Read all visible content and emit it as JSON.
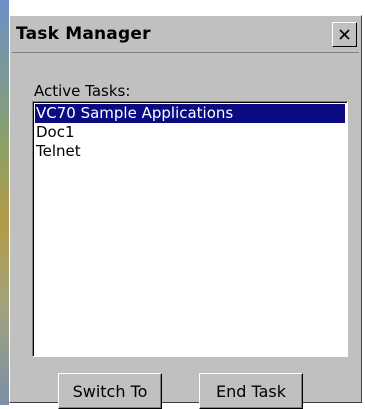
{
  "window": {
    "title": "Task Manager",
    "close_icon": "close-icon"
  },
  "tasks": {
    "label": "Active Tasks:",
    "items": [
      {
        "label": "VC70 Sample Applications",
        "selected": true
      },
      {
        "label": "Doc1",
        "selected": false
      },
      {
        "label": "Telnet",
        "selected": false
      }
    ]
  },
  "buttons": {
    "switch_label": "Switch To",
    "end_label": "End Task"
  },
  "colors": {
    "window_bg": "#c0c0c0",
    "selection_bg": "#0a0a82",
    "selection_text": "#ffffff"
  }
}
